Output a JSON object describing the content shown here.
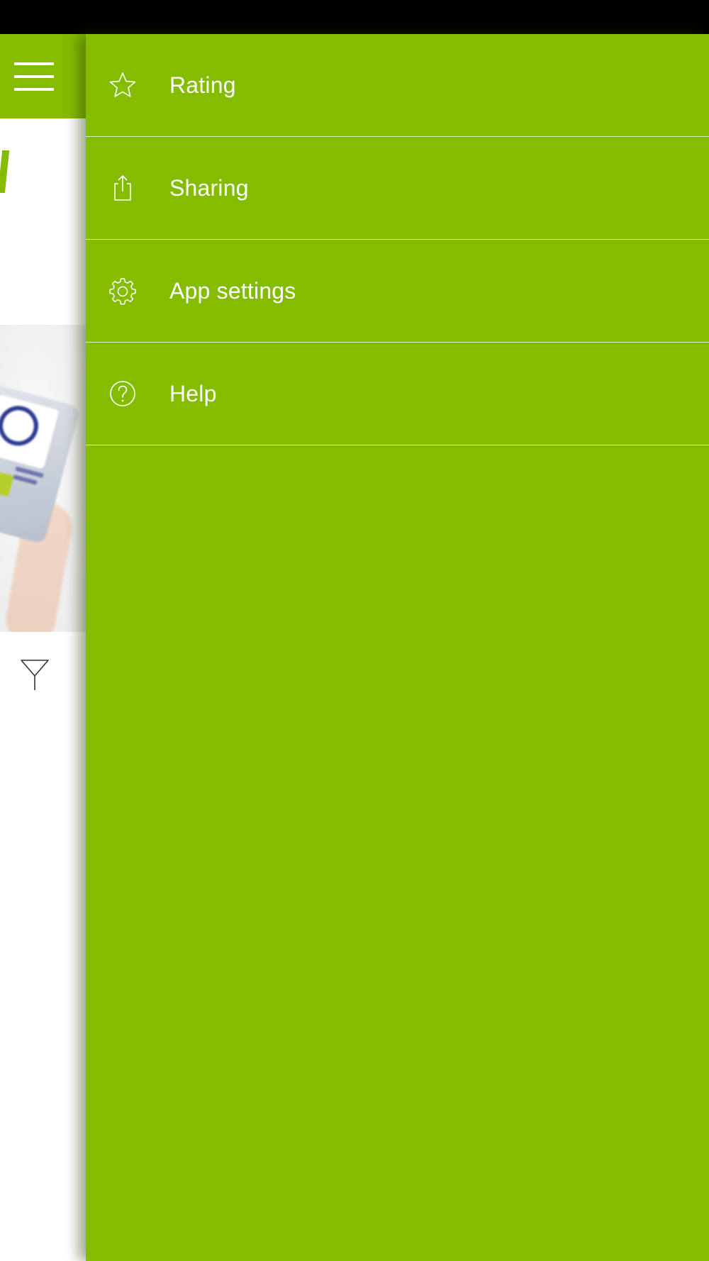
{
  "colors": {
    "brand_green": "#84bc00",
    "status_bar": "#000000",
    "text_on_brand": "#ffffff"
  },
  "underlay": {
    "menu_icon": "hamburger-menu-icon",
    "filter_icon": "filter-icon"
  },
  "drawer": {
    "items": [
      {
        "label": "Rating",
        "icon": "star-icon"
      },
      {
        "label": "Sharing",
        "icon": "share-icon"
      },
      {
        "label": "App settings",
        "icon": "gear-icon"
      },
      {
        "label": "Help",
        "icon": "help-icon"
      }
    ]
  }
}
